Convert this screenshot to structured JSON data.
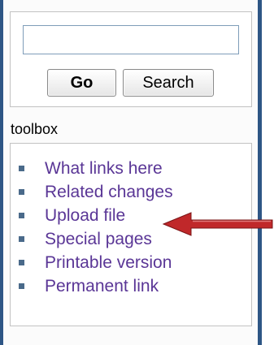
{
  "search": {
    "input_value": "",
    "go_label": "Go",
    "search_label": "Search"
  },
  "toolbox": {
    "title": "toolbox",
    "items": [
      {
        "label": "What links here"
      },
      {
        "label": "Related changes"
      },
      {
        "label": "Upload file"
      },
      {
        "label": "Special pages"
      },
      {
        "label": "Printable version"
      },
      {
        "label": "Permanent link"
      }
    ]
  },
  "annotation": {
    "arrow_color": "#c0282a",
    "arrow_points_to": "Upload file"
  },
  "colors": {
    "frame_border": "#2e5685",
    "link": "#5a3696",
    "bullet": "#4a6a8a"
  }
}
